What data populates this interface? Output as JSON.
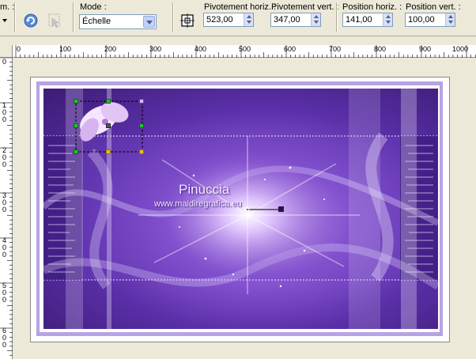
{
  "toolbar": {
    "partial_label": "m. :",
    "mode_label": "Mode :",
    "mode_value": "Échelle",
    "pivot_h_label": "Pivotement horiz. :",
    "pivot_h_value": "523,00",
    "pivot_v_label": "Pivotement vert. :",
    "pivot_v_value": "347,00",
    "pos_h_label": "Position horiz. :",
    "pos_h_value": "141,00",
    "pos_v_label": "Position vert. :",
    "pos_v_value": "100,00"
  },
  "ruler": {
    "h_labels": [
      "0",
      "100",
      "200",
      "300",
      "400",
      "500",
      "600",
      "700",
      "800",
      "900",
      "1000"
    ],
    "v_labels": [
      "0",
      "100",
      "200",
      "300",
      "400",
      "500",
      "600"
    ]
  },
  "artwork": {
    "title": "Pinuccia",
    "website": "www.maidiregrafica.eu"
  },
  "colors": {
    "ui_background": "#ece9d8",
    "frame": "#b8a3e2",
    "art_dark": "#3b1c74",
    "art_light": "#c9a6ef",
    "handle_green": "#22c22a",
    "handle_yellow": "#e8c020"
  }
}
